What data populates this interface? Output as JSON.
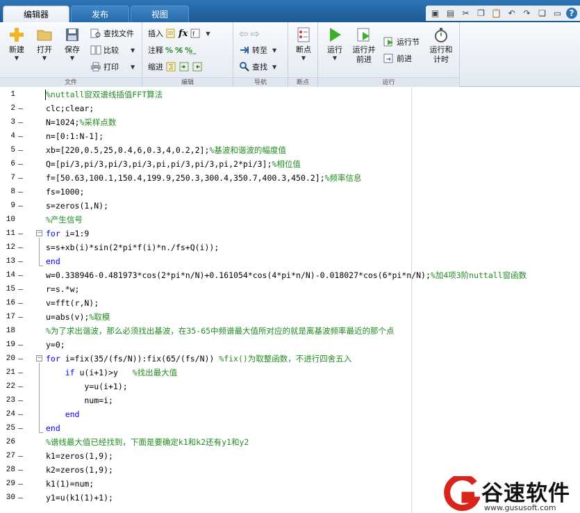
{
  "tabs": [
    {
      "label": "编辑器",
      "active": true
    },
    {
      "label": "发布",
      "active": false
    },
    {
      "label": "视图",
      "active": false
    }
  ],
  "ribbon": {
    "file": {
      "new_label": "新建",
      "open_label": "打开",
      "save_label": "保存",
      "find_files_label": "查找文件",
      "compare_label": "比较",
      "print_label": "打印",
      "group_label": "文件"
    },
    "edit": {
      "insert_label": "插入",
      "comment_label": "注释",
      "indent_label": "缩进",
      "group_label": "编辑"
    },
    "navigate": {
      "goto_label": "转至",
      "find_label": "查找",
      "group_label": "导航"
    },
    "breakpoints": {
      "breakpoints_label": "断点",
      "group_label": "断点"
    },
    "run": {
      "run_label": "运行",
      "run_advance_label_1": "运行并",
      "run_advance_label_2": "前进",
      "run_section_label": "运行节",
      "advance_label": "前进",
      "run_time_label_1": "运行和",
      "run_time_label_2": "计时",
      "group_label": "运行"
    }
  },
  "editor": {
    "lines": [
      {
        "n": "1",
        "dash": "",
        "parts": [
          {
            "t": "%nuttall窗双谱线插值FFT算法",
            "c": "cm"
          }
        ]
      },
      {
        "n": "2",
        "dash": "—",
        "parts": [
          {
            "t": "clc;clear;",
            "c": ""
          }
        ]
      },
      {
        "n": "3",
        "dash": "—",
        "parts": [
          {
            "t": "N=1024;",
            "c": ""
          },
          {
            "t": "%采样点数",
            "c": "cm"
          }
        ]
      },
      {
        "n": "4",
        "dash": "—",
        "parts": [
          {
            "t": "n=[0:1:N-1];",
            "c": ""
          }
        ]
      },
      {
        "n": "5",
        "dash": "—",
        "parts": [
          {
            "t": "xb=[220,0.5,25,0.4,6,0.3,4,0.2,2];",
            "c": ""
          },
          {
            "t": "%基波和谐波的幅度值",
            "c": "cm"
          }
        ]
      },
      {
        "n": "6",
        "dash": "—",
        "parts": [
          {
            "t": "Q=[pi/3,pi/3,pi/3,pi/3,pi,pi/3,pi/3,pi,2*pi/3];",
            "c": ""
          },
          {
            "t": "%相位值",
            "c": "cm"
          }
        ]
      },
      {
        "n": "7",
        "dash": "—",
        "parts": [
          {
            "t": "f=[50.63,100.1,150.4,199.9,250.3,300.4,350.7,400.3,450.2];",
            "c": ""
          },
          {
            "t": "%频率信息",
            "c": "cm"
          }
        ]
      },
      {
        "n": "8",
        "dash": "—",
        "parts": [
          {
            "t": "fs=1000;",
            "c": ""
          }
        ]
      },
      {
        "n": "9",
        "dash": "—",
        "parts": [
          {
            "t": "s=zeros(1,N);",
            "c": ""
          }
        ]
      },
      {
        "n": "10",
        "dash": "",
        "parts": [
          {
            "t": "%产生信号",
            "c": "cm"
          }
        ]
      },
      {
        "n": "11",
        "dash": "—",
        "parts": [
          {
            "t": "for",
            "c": "kw"
          },
          {
            "t": " i=1:9",
            "c": ""
          }
        ]
      },
      {
        "n": "12",
        "dash": "—",
        "parts": [
          {
            "t": "s=s+xb(i)*sin(2*pi*f(i)*n./fs+Q(i));",
            "c": ""
          }
        ]
      },
      {
        "n": "13",
        "dash": "—",
        "parts": [
          {
            "t": "end",
            "c": "kw"
          }
        ]
      },
      {
        "n": "14",
        "dash": "—",
        "parts": [
          {
            "t": "w=0.338946-0.481973*cos(2*pi*n/N)+0.161054*cos(4*pi*n/N)-0.018027*cos(6*pi*n/N);",
            "c": ""
          },
          {
            "t": "%加4项3阶nuttall窗函数",
            "c": "cm"
          }
        ]
      },
      {
        "n": "15",
        "dash": "—",
        "parts": [
          {
            "t": "r=s.*w;",
            "c": ""
          }
        ]
      },
      {
        "n": "16",
        "dash": "—",
        "parts": [
          {
            "t": "v=fft(r,N);",
            "c": ""
          }
        ]
      },
      {
        "n": "17",
        "dash": "—",
        "parts": [
          {
            "t": "u=abs(v);",
            "c": ""
          },
          {
            "t": "%取模",
            "c": "cm"
          }
        ]
      },
      {
        "n": "18",
        "dash": "",
        "parts": [
          {
            "t": "%为了求出谐波，那么必须找出基波，在35-65中频谱最大值所对应的就是离基波频率最近的那个点",
            "c": "cm"
          }
        ]
      },
      {
        "n": "19",
        "dash": "—",
        "parts": [
          {
            "t": "y=0;",
            "c": ""
          }
        ]
      },
      {
        "n": "20",
        "dash": "—",
        "parts": [
          {
            "t": "for",
            "c": "kw"
          },
          {
            "t": " i=fix(35/(fs/N)):fix(65/(fs/N)) ",
            "c": ""
          },
          {
            "t": "%fix()为取整函数，不进行四舍五入",
            "c": "cm"
          }
        ]
      },
      {
        "n": "21",
        "dash": "—",
        "parts": [
          {
            "t": "    ",
            "c": ""
          },
          {
            "t": "if",
            "c": "kw"
          },
          {
            "t": " u(i+1)>y   ",
            "c": ""
          },
          {
            "t": "%找出最大值",
            "c": "cm"
          }
        ]
      },
      {
        "n": "22",
        "dash": "—",
        "parts": [
          {
            "t": "        y=u(i+1);",
            "c": ""
          }
        ]
      },
      {
        "n": "23",
        "dash": "—",
        "parts": [
          {
            "t": "        num=i;",
            "c": ""
          }
        ]
      },
      {
        "n": "24",
        "dash": "—",
        "parts": [
          {
            "t": "    ",
            "c": ""
          },
          {
            "t": "end",
            "c": "kw"
          }
        ]
      },
      {
        "n": "25",
        "dash": "—",
        "parts": [
          {
            "t": "end",
            "c": "kw"
          }
        ]
      },
      {
        "n": "26",
        "dash": "",
        "parts": [
          {
            "t": "%谱线最大值已经找到，下面是要确定k1和k2还有y1和y2",
            "c": "cm"
          }
        ]
      },
      {
        "n": "27",
        "dash": "—",
        "parts": [
          {
            "t": "k1=zeros(1,9);",
            "c": ""
          }
        ]
      },
      {
        "n": "28",
        "dash": "—",
        "parts": [
          {
            "t": "k2=zeros(1,9);",
            "c": ""
          }
        ]
      },
      {
        "n": "29",
        "dash": "—",
        "parts": [
          {
            "t": "k1(1)=num;",
            "c": ""
          }
        ]
      },
      {
        "n": "30",
        "dash": "—",
        "parts": [
          {
            "t": "y1=u(k1(1)+1);",
            "c": ""
          }
        ]
      }
    ]
  },
  "watermark": {
    "text": "谷速软件",
    "url": "www.gususoft.com"
  },
  "colors": {
    "keyword": "#0000ff",
    "comment": "#228b22",
    "ribbon_tab": "#2e74b5"
  }
}
